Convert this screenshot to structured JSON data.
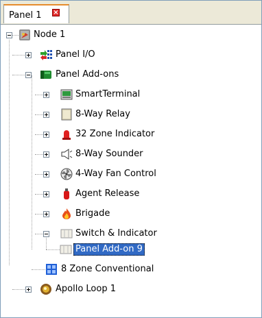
{
  "tab": {
    "label": "Panel 1"
  },
  "tree": {
    "node": "Node 1",
    "panel_io": "Panel I/O",
    "panel_addons": "Panel Add-ons",
    "addons": [
      "SmartTerminal",
      "8-Way Relay",
      "32 Zone Indicator",
      "8-Way Sounder",
      "4-Way Fan Control",
      "Agent Release",
      "Brigade",
      "Switch & Indicator"
    ],
    "switch_child": "Panel Add-on 9",
    "conventional": "8 Zone Conventional",
    "loop": "Apollo Loop 1"
  },
  "colors": {
    "tab_accent": "#e68b2c",
    "close_button": "#e12b2b",
    "selection": "#316ac5"
  }
}
